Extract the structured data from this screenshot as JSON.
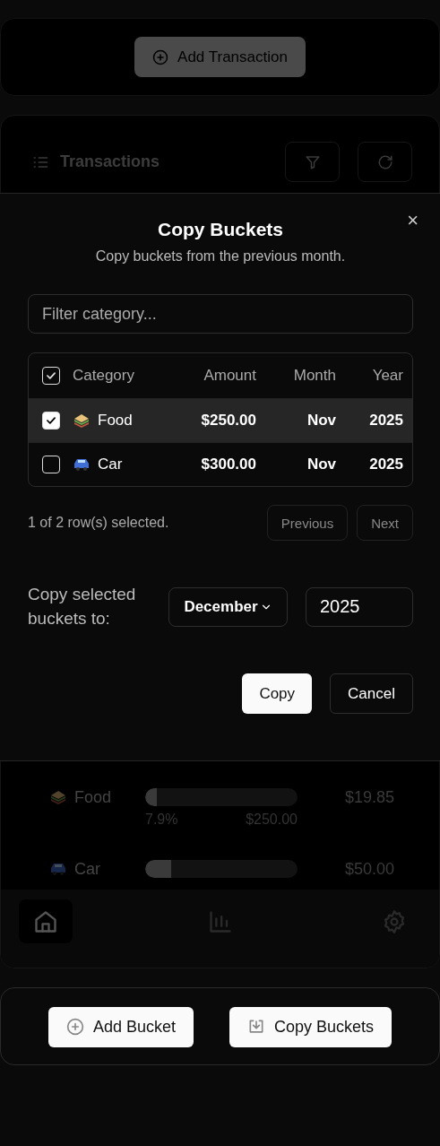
{
  "top_card": {
    "add_button": "Add Transaction"
  },
  "transactions": {
    "title": "Transactions",
    "buckets": [
      {
        "name": "Food",
        "level": 0.079,
        "percent": "7.9%",
        "budget": "$250.00",
        "spent": "$19.85"
      },
      {
        "name": "Car",
        "level": 0.17,
        "spent": "$50.00"
      }
    ],
    "nav": [
      {
        "selected": true
      },
      {
        "selected": false
      },
      {
        "selected": false
      }
    ]
  },
  "dialog": {
    "title": "Copy Buckets",
    "subtitle": "Copy buckets from the previous month.",
    "close": "×",
    "filter": {
      "placeholder": "Filter category..."
    },
    "table": {
      "header_checked": true,
      "columns": [
        "Category",
        "Amount",
        "Month",
        "Year"
      ],
      "rows": [
        {
          "selected": true,
          "category": "Food",
          "amount": "$250.00",
          "month": "Nov",
          "year": "2025"
        },
        {
          "selected": false,
          "category": "Car",
          "amount": "$300.00",
          "month": "Nov",
          "year": "2025"
        }
      ]
    },
    "selection_text": "1 of 2 row(s) selected.",
    "pager": [
      "Previous",
      "Next"
    ],
    "target_label": "Copy selected buckets to:",
    "month": "December",
    "year": "2025",
    "actions": [
      {
        "label": "Copy",
        "kind": "primary"
      },
      {
        "label": "Cancel",
        "kind": "outline"
      }
    ]
  },
  "bottom_card": {
    "buttons": [
      {
        "label": "Add Bucket",
        "kind": "add"
      },
      {
        "label": "Copy Buckets",
        "kind": "copy"
      }
    ]
  }
}
